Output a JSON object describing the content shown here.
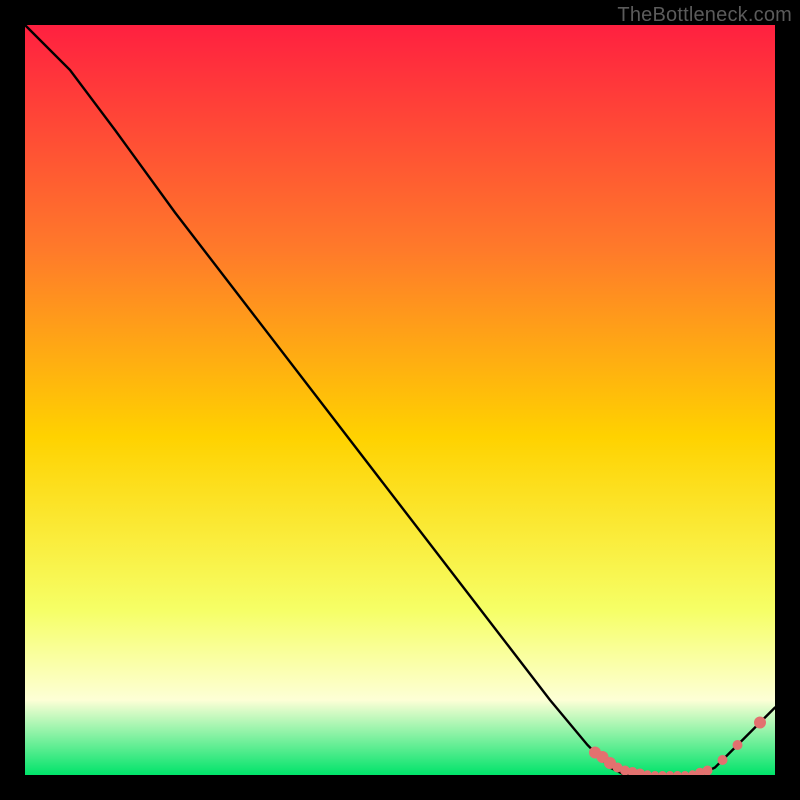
{
  "attribution": "TheBottleneck.com",
  "colors": {
    "bg": "#000000",
    "grad_top": "#ff2040",
    "grad_upper_mid": "#ff7a2a",
    "grad_mid": "#ffd200",
    "grad_lower_mid": "#f6ff66",
    "grad_pale": "#fdffd6",
    "grad_green": "#00e36a",
    "curve": "#000000",
    "marker": "#e2716f"
  },
  "chart_data": {
    "type": "line",
    "title": "",
    "xlabel": "",
    "ylabel": "",
    "xlim": [
      0,
      100
    ],
    "ylim": [
      0,
      100
    ],
    "grid": false,
    "series": [
      {
        "name": "curve",
        "x": [
          0,
          6,
          12,
          20,
          30,
          40,
          50,
          60,
          70,
          75,
          78,
          80,
          82,
          84,
          86,
          88,
          90,
          92,
          94,
          96,
          98,
          100
        ],
        "y": [
          100,
          94,
          86,
          75,
          62,
          49,
          36,
          23,
          10,
          4,
          1,
          0,
          0,
          0,
          0,
          0,
          0,
          1,
          3,
          5,
          7,
          9
        ]
      }
    ],
    "markers": {
      "name": "highlight-cluster",
      "x": [
        76,
        77,
        78,
        79,
        80,
        81,
        82,
        83,
        84,
        85,
        86,
        87,
        88,
        89,
        90,
        91,
        93,
        95,
        98
      ],
      "y": [
        3,
        2.4,
        1.6,
        1,
        0.6,
        0.4,
        0.2,
        0.1,
        0,
        0,
        0,
        0,
        0,
        0.1,
        0.3,
        0.6,
        2,
        4,
        7
      ],
      "size": [
        6,
        6,
        6,
        5,
        5,
        5,
        5,
        4,
        4,
        4,
        4,
        4,
        4,
        4,
        5,
        5,
        5,
        5,
        6
      ]
    }
  }
}
